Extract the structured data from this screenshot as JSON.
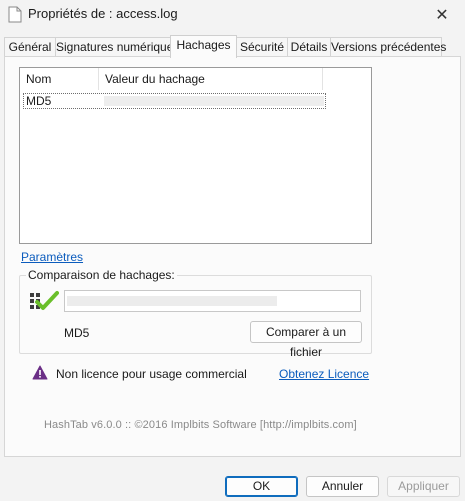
{
  "window": {
    "title": "Propriétés de : access.log",
    "close_label": "✕"
  },
  "tabs": [
    {
      "label": "Général"
    },
    {
      "label": "Signatures numériques"
    },
    {
      "label": "Hachages",
      "active": true
    },
    {
      "label": "Sécurité"
    },
    {
      "label": "Détails"
    },
    {
      "label": "Versions précédentes"
    }
  ],
  "hash_list": {
    "columns": [
      "Nom",
      "Valeur du hachage"
    ],
    "rows": [
      {
        "name": "MD5",
        "value": ""
      }
    ]
  },
  "settings_link": "Paramètres",
  "compare": {
    "group_label": "Comparaison de hachages:",
    "input_value": "",
    "algorithm": "MD5",
    "compare_button": "Comparer à un fichier"
  },
  "license": {
    "text": "Non licence pour usage commercial",
    "link": "Obtenez Licence"
  },
  "credit": "HashTab v6.0.0 :: ©2016 Implbits Software [http://implbits.com]",
  "buttons": {
    "ok": "OK",
    "cancel": "Annuler",
    "apply": "Appliquer"
  },
  "colors": {
    "link": "#0b5cbd",
    "check_green": "#6abf2a",
    "warning_purple": "#6b2f86",
    "ok_border": "#0f6cbd"
  }
}
